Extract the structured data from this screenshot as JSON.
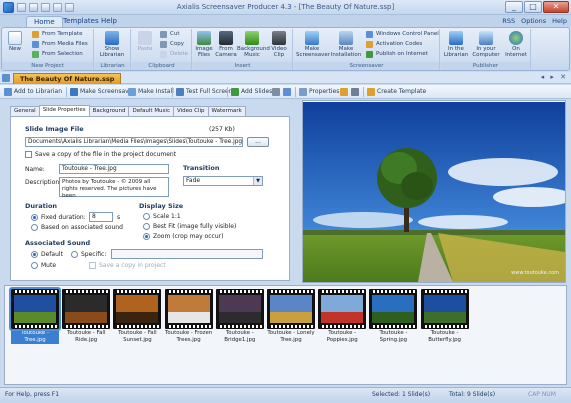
{
  "window": {
    "title": "Axialis Screensaver Producer 4.3 - [The Beauty Of Nature.ssp]",
    "controls": [
      "_",
      "□",
      "✕"
    ]
  },
  "ribbon_tabs": [
    "Home",
    "Templates",
    "Help"
  ],
  "ribbon_right": {
    "rss": "RSS",
    "options": "Options",
    "help": "Help"
  },
  "ribbon": {
    "new_project": {
      "label": "New Project",
      "new": "New",
      "from_template": "From Template",
      "from_media": "From Media Files",
      "from_selection": "From Selection"
    },
    "librarian": {
      "label": "Librarian",
      "show": "Show Librarian"
    },
    "clipboard": {
      "label": "Clipboard",
      "paste": "Paste",
      "cut": "Cut",
      "copy": "Copy",
      "delete": "Delete"
    },
    "insert": {
      "label": "Insert",
      "image_files": "Image Files",
      "from_camera": "From Camera",
      "background_music": "Background Music",
      "video_clip": "Video Clip"
    },
    "screensaver": {
      "label": "Screensaver",
      "make_screensaver": "Make Screensaver",
      "make_installation": "Make Installation",
      "windows_control_panel": "Windows Control Panel",
      "activation_codes": "Activation Codes",
      "publish_internet": "Publish on Internet"
    },
    "publisher": {
      "label": "Publisher",
      "in_librarian": "In the Librarian",
      "in_computer": "In your Computer",
      "on_internet": "On Internet"
    }
  },
  "document_tab": "The Beauty Of Nature.ssp",
  "toolbar": {
    "add_to_librarian": "Add to Librarian",
    "make_screensaver": "Make Screensaver",
    "make_install": "Make Install",
    "test_full_screen": "Test Full Screen",
    "add_slides": "Add Slides",
    "properties": "Properties",
    "create_template": "Create Template"
  },
  "panel_tabs": [
    "General",
    "Slide Properties",
    "Background",
    "Default Music",
    "Video Clip",
    "Watermark"
  ],
  "slide": {
    "section_title": "Slide Image File",
    "file_size": "(257 Kb)",
    "file_path": "Documents\\Axialis Librarian\\Media Files\\Images\\Slides\\Toutouke - Tree.jpg",
    "browse": "...",
    "save_copy": "Save a copy of the file in the project document",
    "name_label": "Name:",
    "name_value": "Toutouke - Tree.jpg",
    "desc_label": "Description:",
    "desc_value": "Photos by Toutouke - © 2009 all rights reserved. The pictures have been",
    "transition_label": "Transition",
    "transition_value": "Fade",
    "duration_label": "Duration",
    "fixed_duration": "Fixed duration:",
    "fixed_value": "8",
    "seconds": "s",
    "based_on_sound": "Based on associated sound",
    "display_size_label": "Display Size",
    "scale": "Scale 1:1",
    "best_fit": "Best Fit (image fully visible)",
    "zoom": "Zoom (crop may occur)",
    "assoc_sound_label": "Associated Sound",
    "default": "Default",
    "specific": "Specific:",
    "mute": "Mute",
    "save_copy_in_project": "Save a copy in project"
  },
  "preview": {
    "caption": "www.toutouke.com"
  },
  "filmstrip": [
    {
      "label": "Toutouke - Tree.jpg",
      "selected": true,
      "sky": "#1f4f9e",
      "ground": "#5a8a2a"
    },
    {
      "label": "Toutouke - Fall Ride.jpg",
      "selected": false,
      "sky": "#2b2b2b",
      "ground": "#8a4b1a"
    },
    {
      "label": "Toutouke - Fall Sunset.jpg",
      "selected": false,
      "sky": "#b0631e",
      "ground": "#3a2410"
    },
    {
      "label": "Toutouke - Frozen Trees.jpg",
      "selected": false,
      "sky": "#c07a3a",
      "ground": "#e6e6e6"
    },
    {
      "label": "Toutouke - Bridge1.jpg",
      "selected": false,
      "sky": "#4c3a55",
      "ground": "#2c2c30"
    },
    {
      "label": "Toutouke - Lonely Tree.jpg",
      "selected": false,
      "sky": "#5a86c8",
      "ground": "#c8a040"
    },
    {
      "label": "Toutouke - Poppies.jpg",
      "selected": false,
      "sky": "#7ea9d8",
      "ground": "#c0342a"
    },
    {
      "label": "Toutouke - Spring.jpg",
      "selected": false,
      "sky": "#2a6fbf",
      "ground": "#2f5f1e"
    },
    {
      "label": "Toutouke - Butterfly.jpg",
      "selected": false,
      "sky": "#1c4fa0",
      "ground": "#3e6e2a"
    }
  ],
  "status": {
    "help": "For Help, press F1",
    "selected": "Selected: 1 Slide(s)",
    "total": "Total: 9 Slide(s)",
    "indicators": "CAP NUM"
  }
}
